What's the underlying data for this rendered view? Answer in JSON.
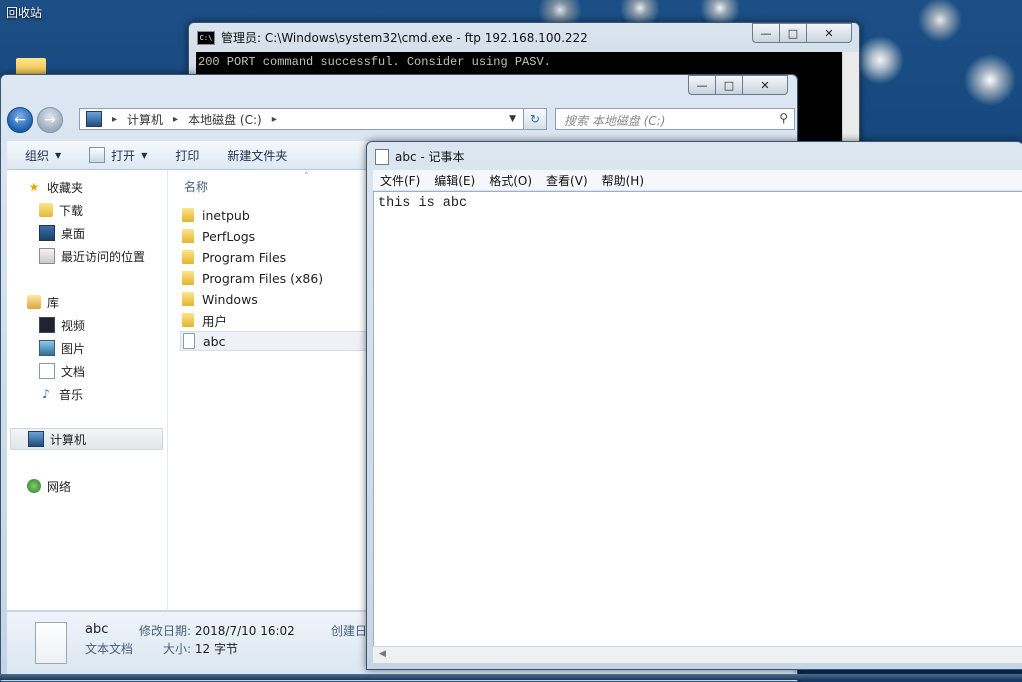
{
  "desktop": {
    "recycle_bin_label": "回收站"
  },
  "cmd": {
    "title": "管理员: C:\\Windows\\system32\\cmd.exe - ftp  192.168.100.222",
    "icon_label": "C:\\",
    "lines": [
      "200 PORT command successful. Consider using PASV."
    ]
  },
  "explorer": {
    "breadcrumb": [
      "计算机",
      "本地磁盘 (C:)"
    ],
    "search_placeholder": "搜索 本地磁盘 (C:)",
    "toolbar": {
      "organize": "组织",
      "open": "打开",
      "print": "打印",
      "new_folder": "新建文件夹"
    },
    "nav": {
      "favorites": "收藏夹",
      "downloads": "下载",
      "desktop": "桌面",
      "recent": "最近访问的位置",
      "libraries": "库",
      "videos": "视频",
      "pictures": "图片",
      "documents": "文档",
      "music": "音乐",
      "computer": "计算机",
      "network": "网络"
    },
    "column_name": "名称",
    "files": [
      {
        "name": "inetpub",
        "type": "folder"
      },
      {
        "name": "PerfLogs",
        "type": "folder"
      },
      {
        "name": "Program Files",
        "type": "folder"
      },
      {
        "name": "Program Files (x86)",
        "type": "folder"
      },
      {
        "name": "Windows",
        "type": "folder"
      },
      {
        "name": "用户",
        "type": "folder"
      },
      {
        "name": "abc",
        "type": "text"
      }
    ],
    "details": {
      "name": "abc",
      "type": "文本文档",
      "modified_label": "修改日期:",
      "modified_value": "2018/7/10 16:02",
      "size_label": "大小:",
      "size_value": "12 字节",
      "created_label": "创建日"
    }
  },
  "notepad": {
    "title": "abc - 记事本",
    "menu": [
      "文件(F)",
      "编辑(E)",
      "格式(O)",
      "查看(V)",
      "帮助(H)"
    ],
    "content": "this is abc"
  }
}
